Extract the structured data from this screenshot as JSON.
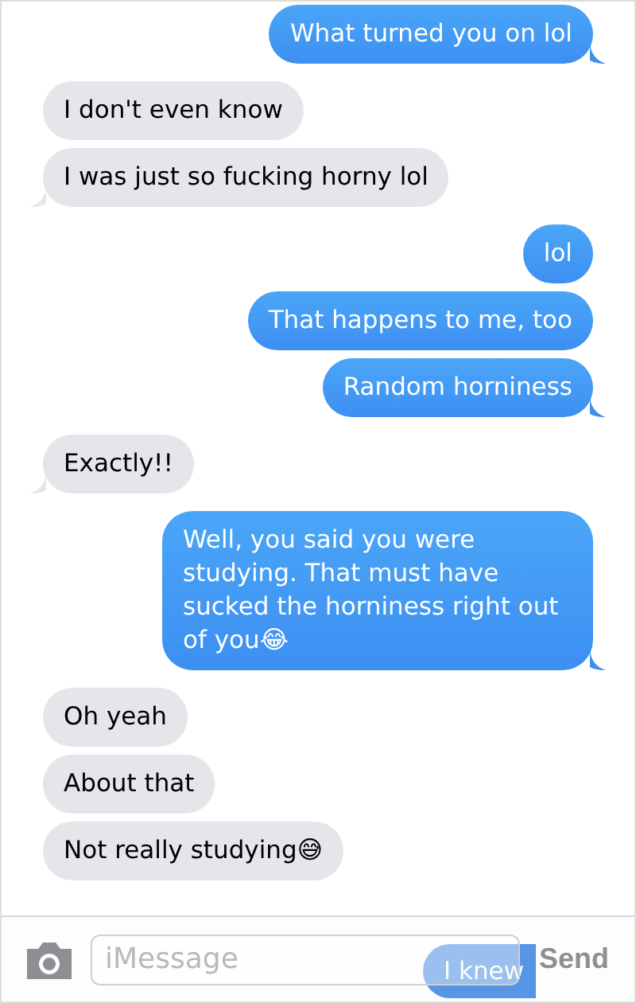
{
  "messages": [
    {
      "kind": "sent",
      "text": "What turned you on lol",
      "tail": true
    },
    {
      "kind": "received",
      "text": "I don't even know",
      "tail": false
    },
    {
      "kind": "received",
      "text": "I was just so fucking horny lol",
      "tail": true
    },
    {
      "kind": "sent",
      "text": "lol",
      "tail": false
    },
    {
      "kind": "sent",
      "text": "That happens to me, too",
      "tail": false
    },
    {
      "kind": "sent",
      "text": "Random horniness",
      "tail": true
    },
    {
      "kind": "received",
      "text": "Exactly!!",
      "tail": true
    },
    {
      "kind": "sent",
      "text": "Well, you said you were studying. That must have sucked the horniness right out of you😂",
      "tail": true
    },
    {
      "kind": "received",
      "text": "Oh yeah",
      "tail": false
    },
    {
      "kind": "received",
      "text": "About that",
      "tail": false
    },
    {
      "kind": "received",
      "text": "Not really studying😅",
      "tail": false
    }
  ],
  "behind_bar": {
    "text": "I knew"
  },
  "composer": {
    "placeholder": "iMessage",
    "send": "Send"
  }
}
